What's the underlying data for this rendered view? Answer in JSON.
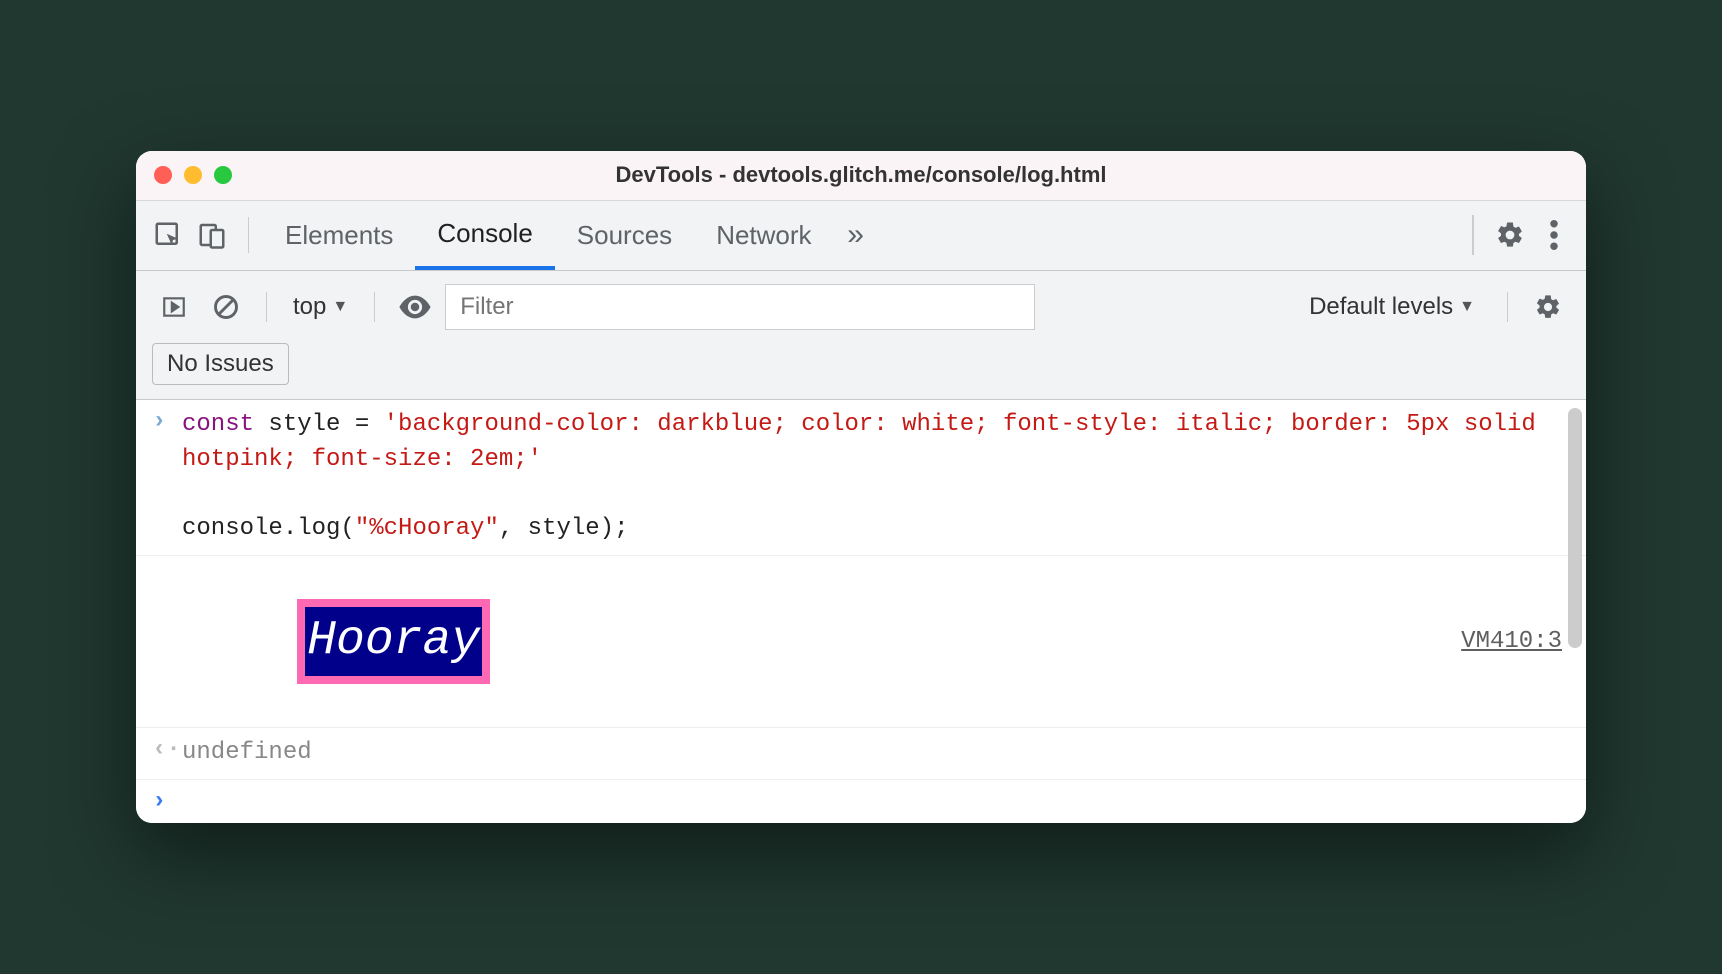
{
  "window": {
    "title": "DevTools - devtools.glitch.me/console/log.html"
  },
  "tabs": {
    "elements": "Elements",
    "console": "Console",
    "sources": "Sources",
    "network": "Network"
  },
  "toolbar": {
    "context": "top",
    "filter_placeholder": "Filter",
    "levels": "Default levels",
    "issues": "No Issues"
  },
  "console": {
    "input_code_html": "<span class=\"kw\">const</span> style = <span class=\"str\">'background-color: darkblue; color: white; font-style: italic; border: 5px solid hotpink; font-size: 2em;'</span>\n\nconsole.log(<span class=\"str\">\"%cHooray\"</span>, style);",
    "styled_output": "Hooray",
    "source_link": "VM410:3",
    "return_value": "undefined"
  }
}
